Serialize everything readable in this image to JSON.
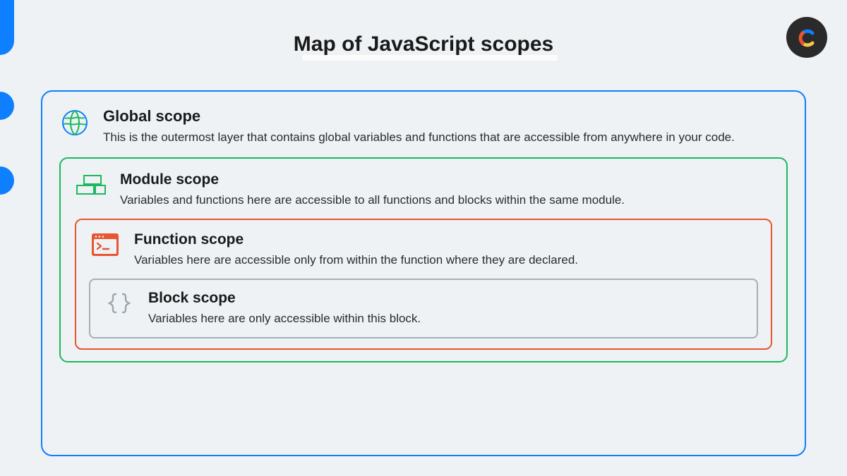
{
  "title": "Map of JavaScript scopes",
  "scopes": {
    "global": {
      "title": "Global scope",
      "desc": "This is the outermost layer that contains global variables and functions that are accessible from anywhere in your code.",
      "border_color": "#0d7fff"
    },
    "module": {
      "title": "Module scope",
      "desc": "Variables and functions here are accessible to all functions and blocks within the same module.",
      "border_color": "#1cb85c"
    },
    "function": {
      "title": "Function scope",
      "desc": "Variables here are accessible only from within the function where they are declared.",
      "border_color": "#e8552f"
    },
    "block": {
      "title": "Block scope",
      "desc": "Variables here are only accessible within this block.",
      "border_color": "#a5afb8"
    }
  }
}
